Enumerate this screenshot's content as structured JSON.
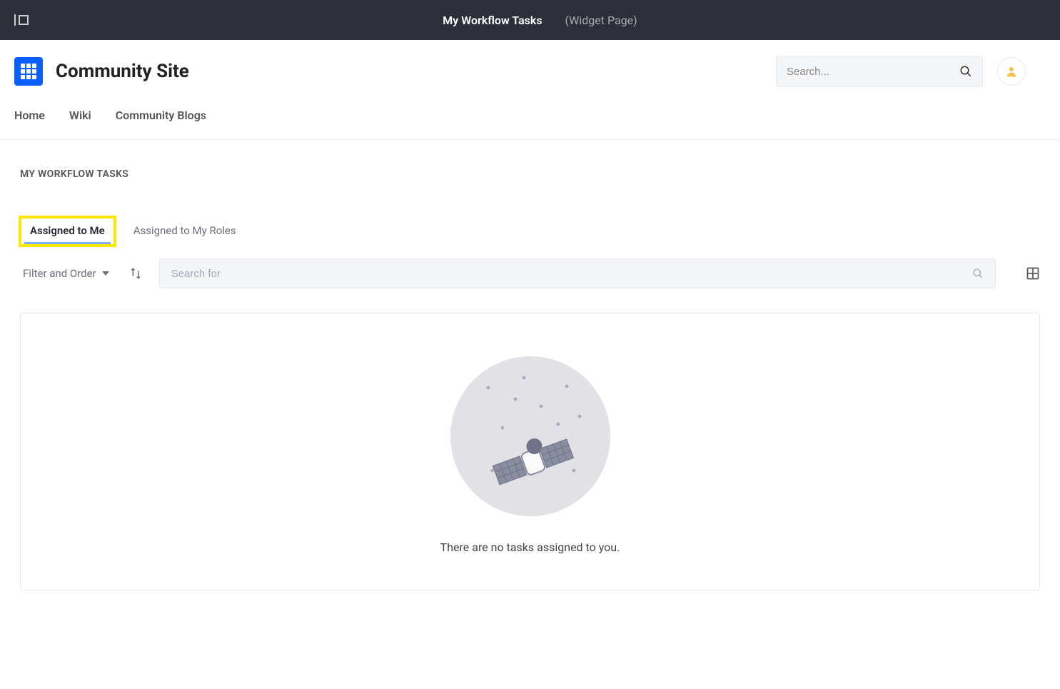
{
  "topbar": {
    "title_main": "My Workflow Tasks",
    "title_sub": "(Widget Page)"
  },
  "header": {
    "site_name": "Community Site",
    "search_placeholder": "Search..."
  },
  "nav": {
    "items": [
      {
        "label": "Home"
      },
      {
        "label": "Wiki"
      },
      {
        "label": "Community Blogs"
      }
    ]
  },
  "page": {
    "caption": "MY WORKFLOW TASKS"
  },
  "tabs": [
    {
      "label": "Assigned to Me",
      "active": true,
      "highlighted": true
    },
    {
      "label": "Assigned to My Roles",
      "active": false,
      "highlighted": false
    }
  ],
  "toolbar": {
    "filter_order_label": "Filter and Order",
    "search_for_placeholder": "Search for"
  },
  "empty_state": {
    "message": "There are no tasks assigned to you."
  }
}
